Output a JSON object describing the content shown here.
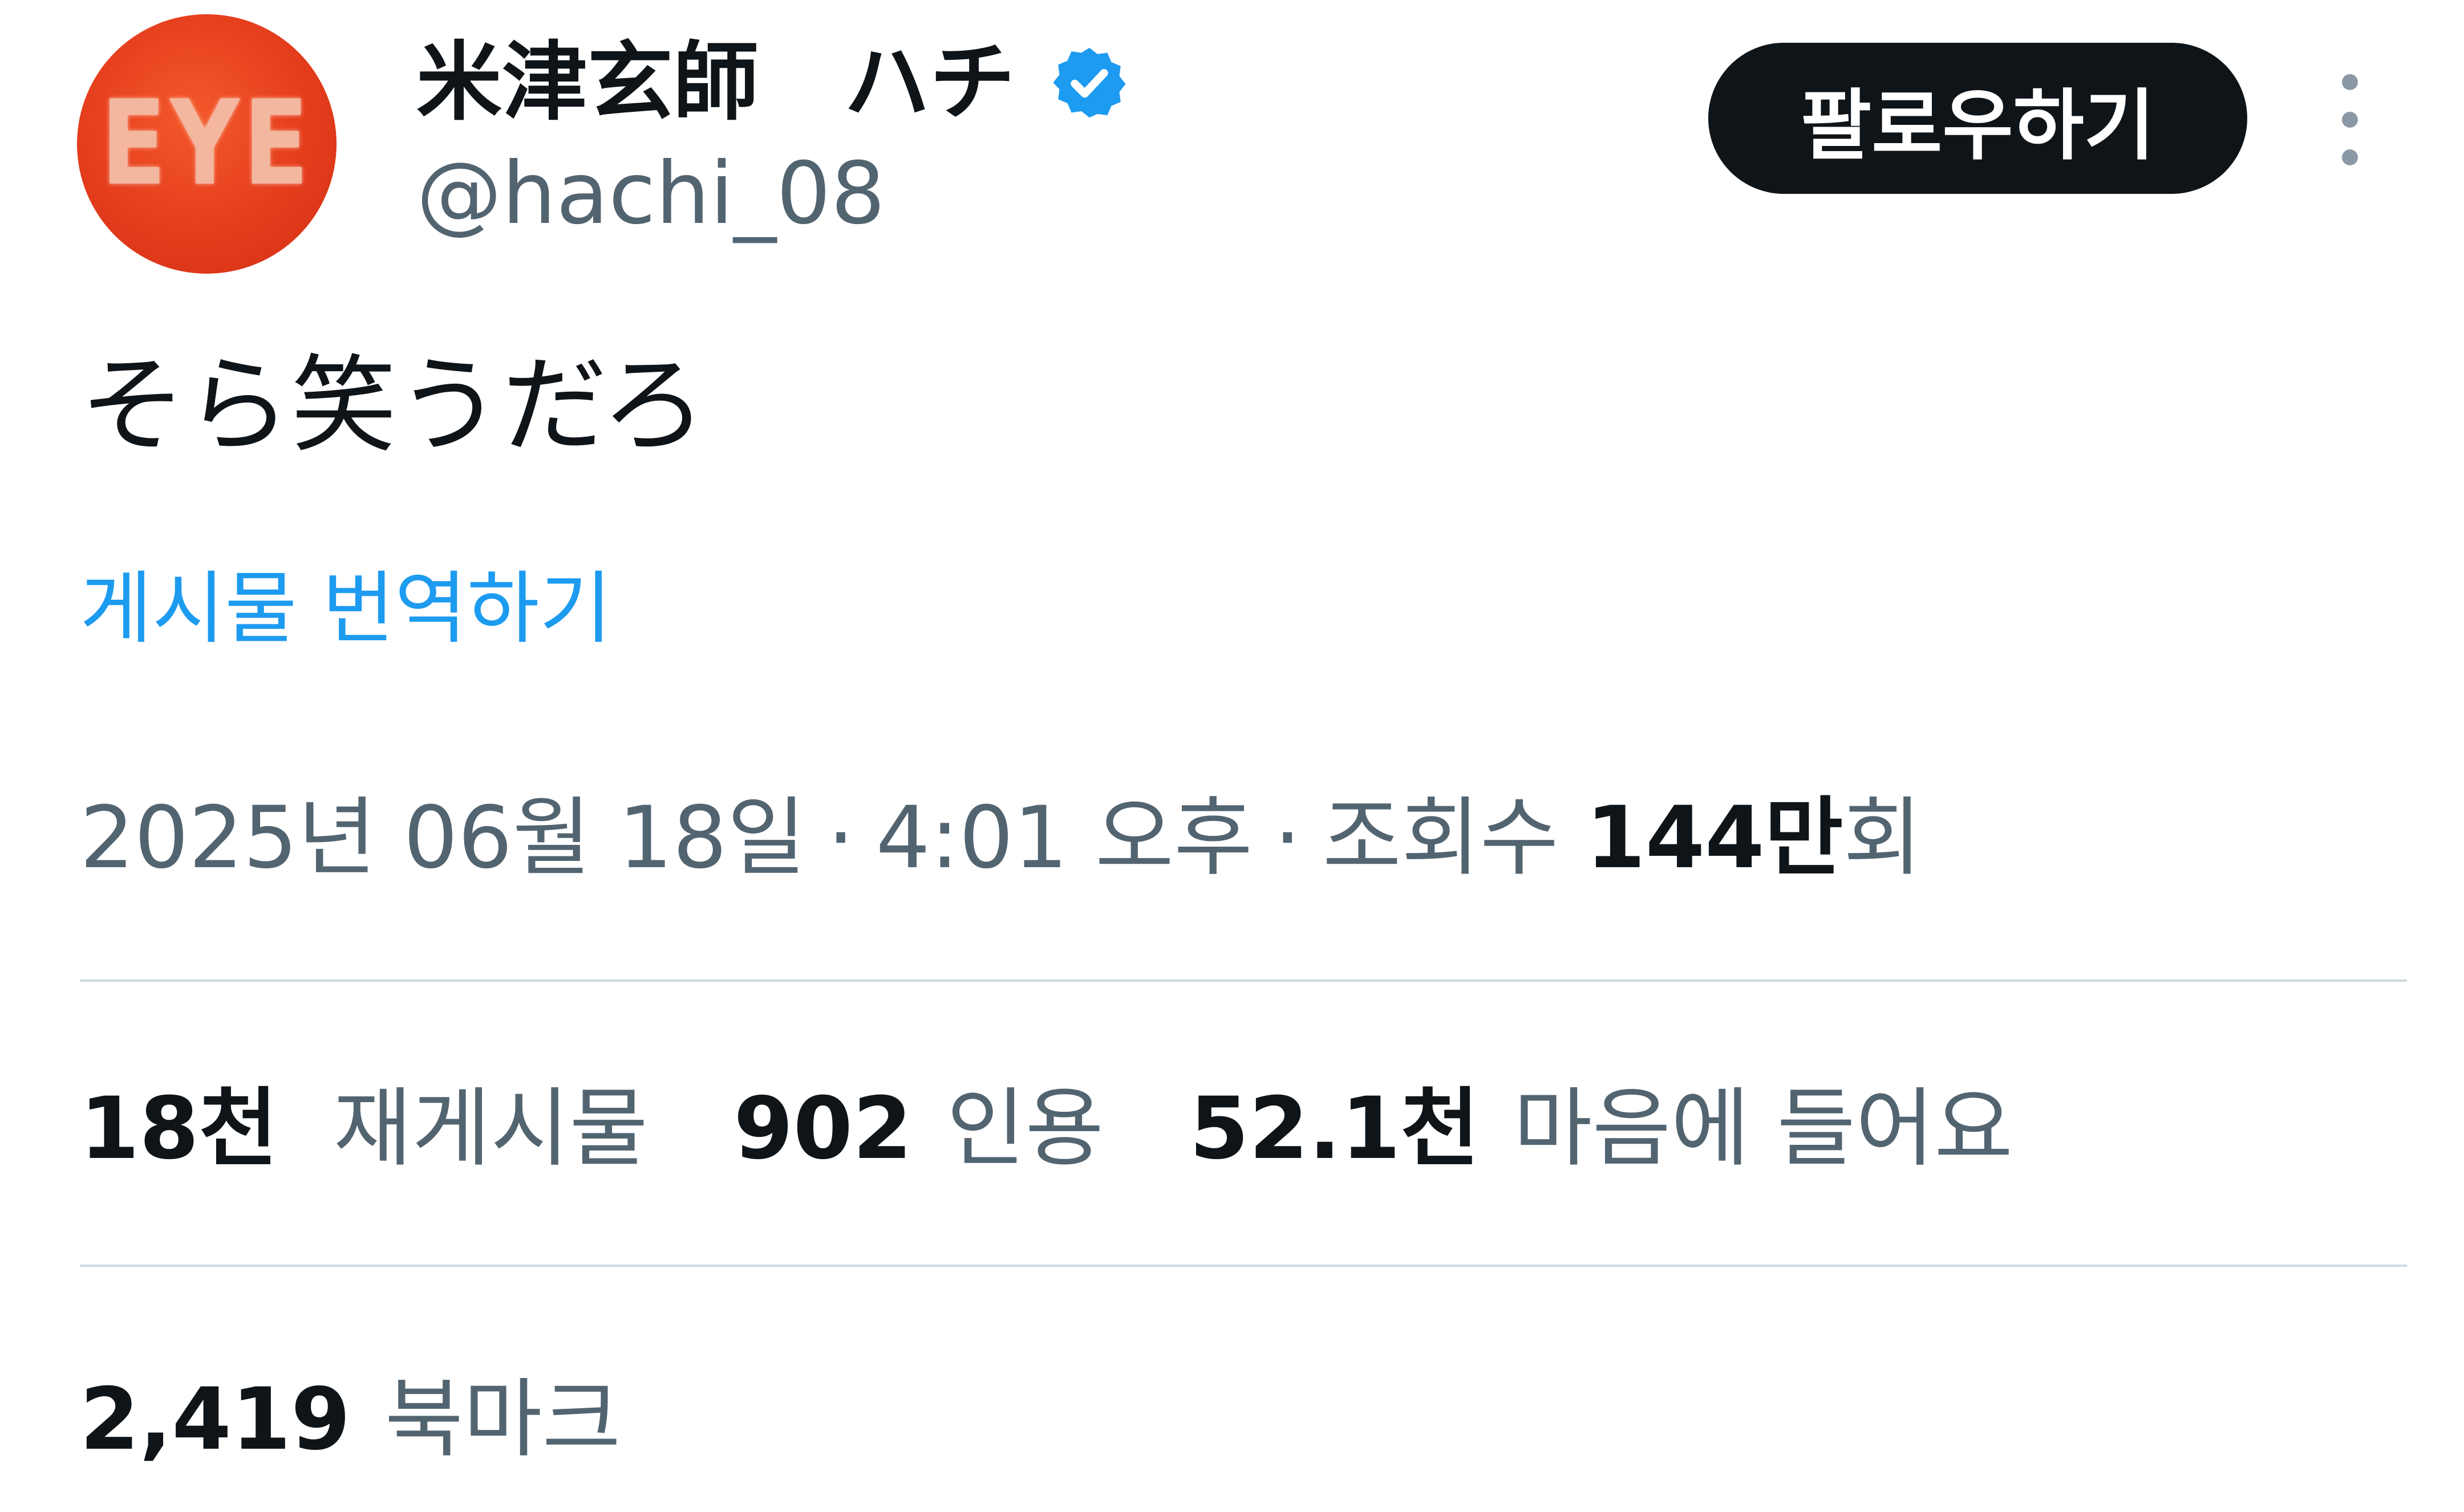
{
  "author": {
    "display_name": "米津玄師　ハチ",
    "handle": "@hachi_08",
    "avatar_text": "EYE",
    "verified": true,
    "avatar_color": "#e43d1d"
  },
  "follow_button": {
    "label": "팔로우하기"
  },
  "more_menu": {
    "icon": "more-vertical-icon"
  },
  "post": {
    "text": "そら笑うだろ",
    "translate_label": "게시물 번역하기"
  },
  "meta": {
    "date": "2025년 06월 18일",
    "separator": "·",
    "time": "4:01 오후",
    "views_label_prefix": "조회수",
    "views_count": "144만",
    "views_label_suffix": "회"
  },
  "stats": {
    "retweets": {
      "count": "18천",
      "label": "재게시물"
    },
    "quotes": {
      "count": "902",
      "label": "인용"
    },
    "likes": {
      "count": "52.1천",
      "label": "마음에 들어요"
    },
    "bookmarks": {
      "count": "2,419",
      "label": "북마크"
    }
  },
  "colors": {
    "text_primary": "#0f1419",
    "text_secondary": "#536471",
    "link": "#1d9bf0",
    "verified": "#1d9bf0",
    "button_bg": "#0f1419",
    "divider": "#cfd9de"
  }
}
